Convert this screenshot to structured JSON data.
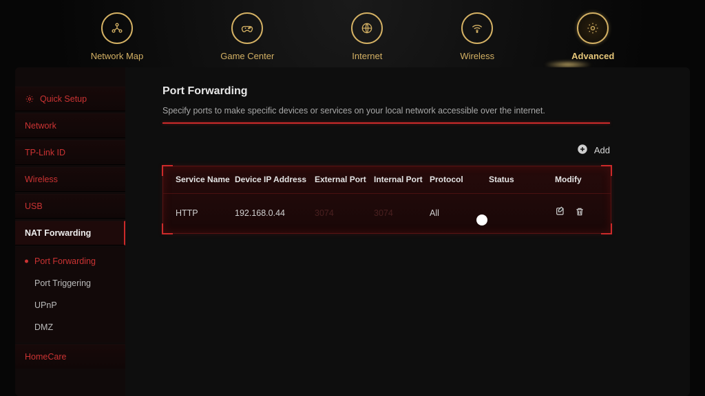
{
  "topnav": [
    {
      "id": "network-map",
      "label": "Network Map",
      "active": false
    },
    {
      "id": "game-center",
      "label": "Game Center",
      "active": false
    },
    {
      "id": "internet",
      "label": "Internet",
      "active": false
    },
    {
      "id": "wireless",
      "label": "Wireless",
      "active": false
    },
    {
      "id": "advanced",
      "label": "Advanced",
      "active": true
    }
  ],
  "sidebar": {
    "items": [
      {
        "id": "quick-setup",
        "label": "Quick Setup",
        "icon": "gear"
      },
      {
        "id": "network",
        "label": "Network"
      },
      {
        "id": "tp-link-id",
        "label": "TP-Link ID"
      },
      {
        "id": "wireless",
        "label": "Wireless"
      },
      {
        "id": "usb",
        "label": "USB"
      },
      {
        "id": "nat-forwarding",
        "label": "NAT Forwarding",
        "active": true,
        "children": [
          {
            "id": "port-forwarding",
            "label": "Port Forwarding",
            "current": true
          },
          {
            "id": "port-triggering",
            "label": "Port Triggering"
          },
          {
            "id": "upnp",
            "label": "UPnP"
          },
          {
            "id": "dmz",
            "label": "DMZ"
          }
        ]
      },
      {
        "id": "homecare",
        "label": "HomeCare"
      }
    ]
  },
  "page": {
    "title": "Port Forwarding",
    "description": "Specify ports to make specific devices or services on your local network accessible over the internet.",
    "add_label": "Add"
  },
  "table": {
    "headers": {
      "service": "Service Name",
      "ip": "Device IP Address",
      "ext": "External Port",
      "int": "Internal Port",
      "proto": "Protocol",
      "status": "Status",
      "modify": "Modify"
    },
    "rows": [
      {
        "service": "HTTP",
        "ip": "192.168.0.44",
        "ext": "3074",
        "int": "3074",
        "proto": "All",
        "status": true
      }
    ]
  }
}
